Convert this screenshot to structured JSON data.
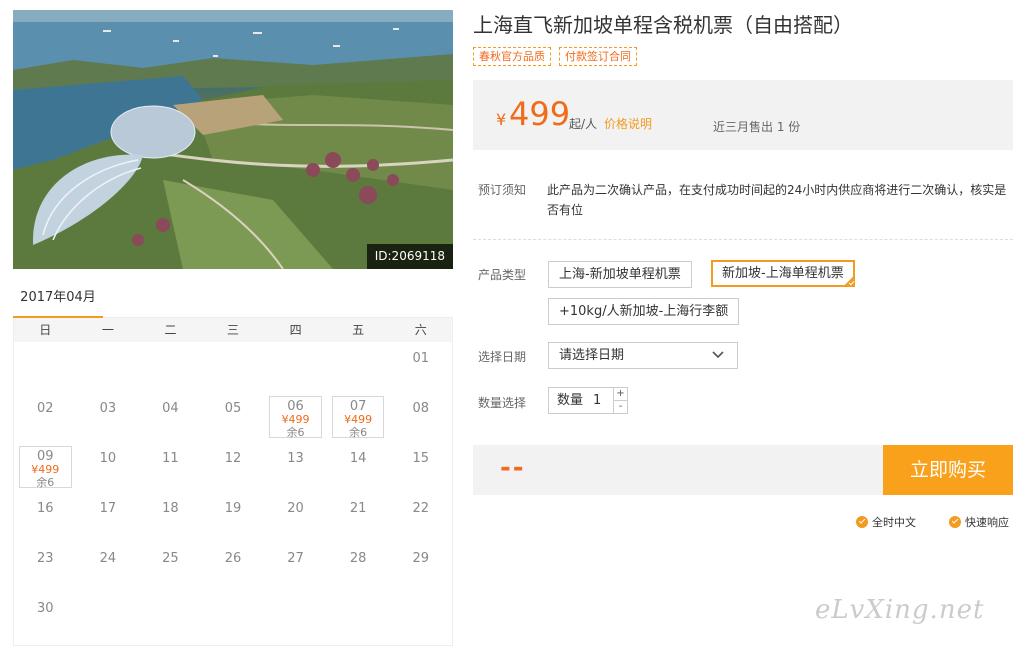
{
  "photo": {
    "id_label": "ID:2069118"
  },
  "calendar": {
    "month_title": "2017年04月",
    "weekdays": [
      "日",
      "一",
      "二",
      "三",
      "四",
      "五",
      "六"
    ],
    "cells": [
      {
        "day": ""
      },
      {
        "day": ""
      },
      {
        "day": ""
      },
      {
        "day": ""
      },
      {
        "day": ""
      },
      {
        "day": ""
      },
      {
        "day": "01"
      },
      {
        "day": "02"
      },
      {
        "day": "03"
      },
      {
        "day": "04"
      },
      {
        "day": "05"
      },
      {
        "day": "06",
        "price": "¥499",
        "stock": "余6"
      },
      {
        "day": "07",
        "price": "¥499",
        "stock": "余6"
      },
      {
        "day": "08"
      },
      {
        "day": "09",
        "price": "¥499",
        "stock": "余6"
      },
      {
        "day": "10"
      },
      {
        "day": "11"
      },
      {
        "day": "12"
      },
      {
        "day": "13"
      },
      {
        "day": "14"
      },
      {
        "day": "15"
      },
      {
        "day": "16"
      },
      {
        "day": "17"
      },
      {
        "day": "18"
      },
      {
        "day": "19"
      },
      {
        "day": "20"
      },
      {
        "day": "21"
      },
      {
        "day": "22"
      },
      {
        "day": "23"
      },
      {
        "day": "24"
      },
      {
        "day": "25"
      },
      {
        "day": "26"
      },
      {
        "day": "27"
      },
      {
        "day": "28"
      },
      {
        "day": "29"
      },
      {
        "day": "30"
      }
    ]
  },
  "product": {
    "title": "上海直飞新加坡单程含税机票（自由搭配）",
    "tags": [
      "春秋官方品质",
      "付款签订合同"
    ],
    "price": {
      "currency": "¥",
      "amount": "499",
      "unit": "起/人",
      "explain_link": "价格说明",
      "sold": "近三月售出 1 份"
    },
    "notice": {
      "label": "预订须知",
      "text": "此产品为二次确认产品，在支付成功时间起的24小时内供应商将进行二次确认，核实是否有位"
    },
    "type": {
      "label": "产品类型",
      "options": [
        "上海-新加坡单程机票",
        "新加坡-上海单程机票",
        "+10kg/人新加坡-上海行李额"
      ],
      "selected_index": 1
    },
    "date": {
      "label": "选择日期",
      "placeholder": "请选择日期"
    },
    "quantity": {
      "label": "数量选择",
      "field_label": "数量",
      "value": "1",
      "plus": "+",
      "minus": "-"
    },
    "total": "--",
    "buy_label": "立即购买",
    "services": [
      "全时中文",
      "快速响应"
    ]
  },
  "watermark": "eLvXing.net",
  "colors": {
    "accent": "#f29b21",
    "price": "#f06b1a",
    "buy_button": "#f9a11b"
  }
}
